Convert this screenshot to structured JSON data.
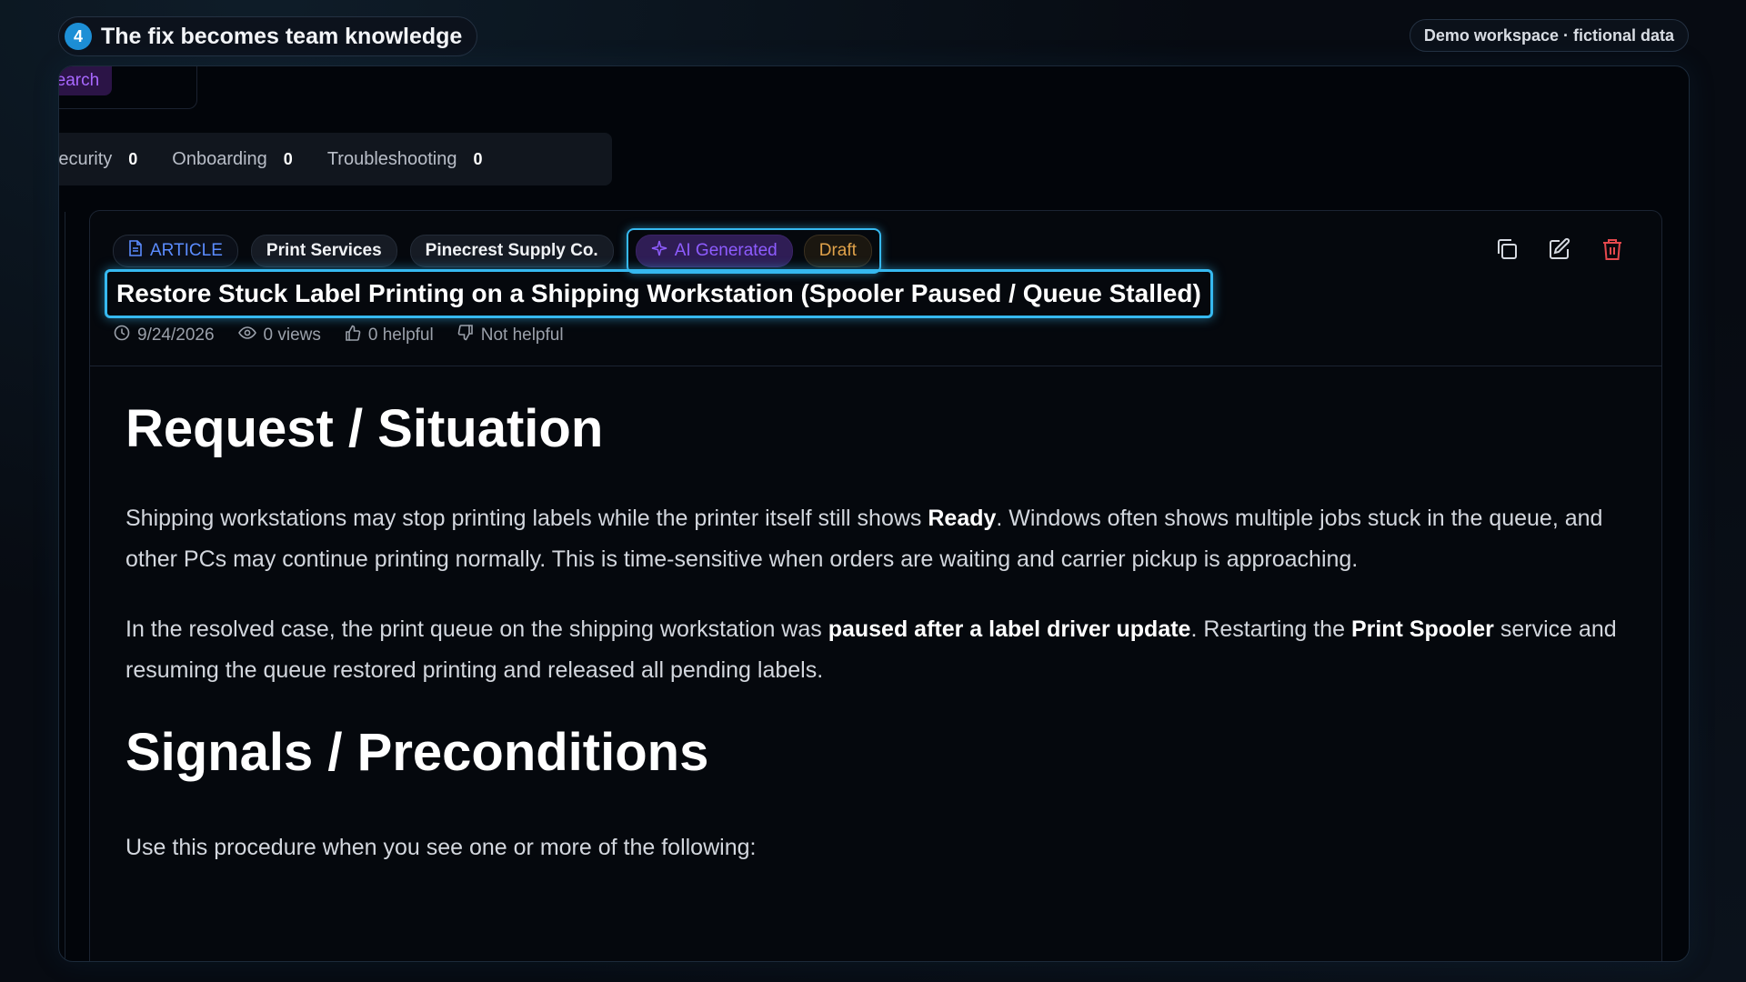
{
  "step": {
    "number": "4",
    "title": "The fix becomes team knowledge"
  },
  "workspace_badge": "Demo workspace · fictional data",
  "search_label": "Search",
  "categories": [
    {
      "label": "Security",
      "count": "0"
    },
    {
      "label": "Onboarding",
      "count": "0"
    },
    {
      "label": "Troubleshooting",
      "count": "0"
    }
  ],
  "article": {
    "type_label": "ARTICLE",
    "category_tag": "Print Services",
    "client_tag": "Pinecrest Supply Co.",
    "ai_tag": "AI Generated",
    "status_tag": "Draft",
    "title": "Restore Stuck Label Printing on a Shipping Workstation (Spooler Paused / Queue Stalled)",
    "meta": {
      "date": "9/24/2026",
      "views": "0 views",
      "helpful": "0 helpful",
      "not_helpful": "Not helpful"
    },
    "body": {
      "h1": "Request / Situation",
      "p1_a": "Shipping workstations may stop printing labels while the printer itself still shows ",
      "p1_b": "Ready",
      "p1_c": ". Windows often shows multiple jobs stuck in the queue, and other PCs may continue printing normally. This is time-sensitive when orders are waiting and carrier pickup is approaching.",
      "p2_a": "In the resolved case, the print queue on the shipping workstation was ",
      "p2_b": "paused after a label driver update",
      "p2_c": ". Restarting the ",
      "p2_d": "Print Spooler",
      "p2_e": " service and resuming the queue restored printing and released all pending labels.",
      "h2": "Signals / Preconditions",
      "p3": "Use this procedure when you see one or more of the following:"
    }
  },
  "colors": {
    "accent_glow": "#36b9f0",
    "ai_purple": "#8e5cff",
    "draft_amber": "#e0a24a",
    "delete_red": "#e5484d",
    "article_blue": "#5b8cff"
  },
  "icons": {
    "copy": "copy-icon",
    "edit": "edit-icon",
    "delete": "trash-icon",
    "clock": "clock-icon",
    "eye": "eye-icon",
    "thumbs_up": "thumbs-up-icon",
    "thumbs_down": "thumbs-down-icon",
    "document": "document-icon",
    "sparkle": "sparkle-icon"
  }
}
